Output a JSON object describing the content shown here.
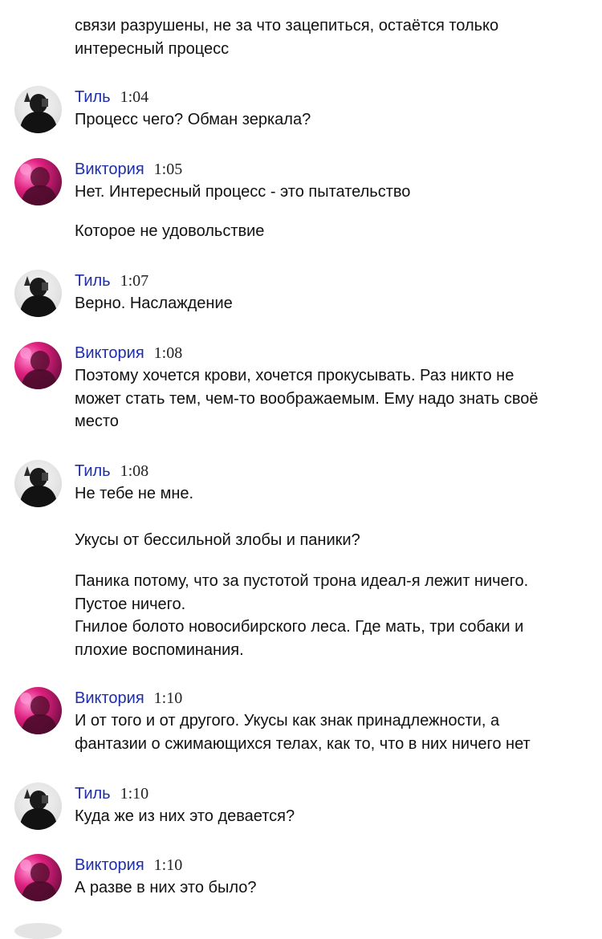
{
  "continuation": {
    "lines": [
      "связи разрушены, не за что зацепиться, остаётся только",
      "интересный процесс"
    ]
  },
  "messages": [
    {
      "author": "Тиль",
      "time": "1:04",
      "avatar_icon": "user-avatar-icon",
      "paragraphs": [
        [
          "Процесс чего? Обман зеркала?"
        ]
      ]
    },
    {
      "author": "Виктория",
      "time": "1:05",
      "avatar_icon": "user-avatar-icon",
      "paragraphs": [
        [
          "Нет. Интересный процесс - это пытательство"
        ],
        [
          "Которое не удовольствие"
        ]
      ]
    },
    {
      "author": "Тиль",
      "time": "1:07",
      "avatar_icon": "user-avatar-icon",
      "paragraphs": [
        [
          "Верно. Наслаждение"
        ]
      ]
    },
    {
      "author": "Виктория",
      "time": "1:08",
      "avatar_icon": "user-avatar-icon",
      "paragraphs": [
        [
          "Поэтому хочется крови, хочется прокусывать. Раз никто не",
          "может стать тем, чем-то воображаемым. Ему надо знать своё",
          "место"
        ]
      ]
    },
    {
      "author": "Тиль",
      "time": "1:08",
      "avatar_icon": "user-avatar-icon",
      "paragraphs": [
        [
          "Не тебе не мне."
        ],
        [
          "Укусы от бессильной злобы и паники?"
        ],
        [
          "Паника потому, что за пустотой трона идеал-я лежит ничего.",
          "Пустое ничего.",
          "Гнилое болото новосибирского леса. Где мать, три собаки и",
          "плохие воспоминания."
        ]
      ]
    },
    {
      "author": "Виктория",
      "time": "1:10",
      "avatar_icon": "user-avatar-icon",
      "paragraphs": [
        [
          "И от того и от другого. Укусы как знак принадлежности, а",
          "фантазии о сжимающихся телах, как то, что в них ничего нет"
        ]
      ]
    },
    {
      "author": "Тиль",
      "time": "1:10",
      "avatar_icon": "user-avatar-icon",
      "paragraphs": [
        [
          "Куда же из них это девается?"
        ]
      ]
    },
    {
      "author": "Виктория",
      "time": "1:10",
      "avatar_icon": "user-avatar-icon",
      "paragraphs": [
        [
          "А разве в них это было?"
        ]
      ]
    }
  ],
  "colors": {
    "author_name": "#1d2ea8",
    "text": "#111111",
    "background": "#ffffff",
    "avatar_til": "#1a1a1a",
    "avatar_viktoria": "#e0207f"
  }
}
